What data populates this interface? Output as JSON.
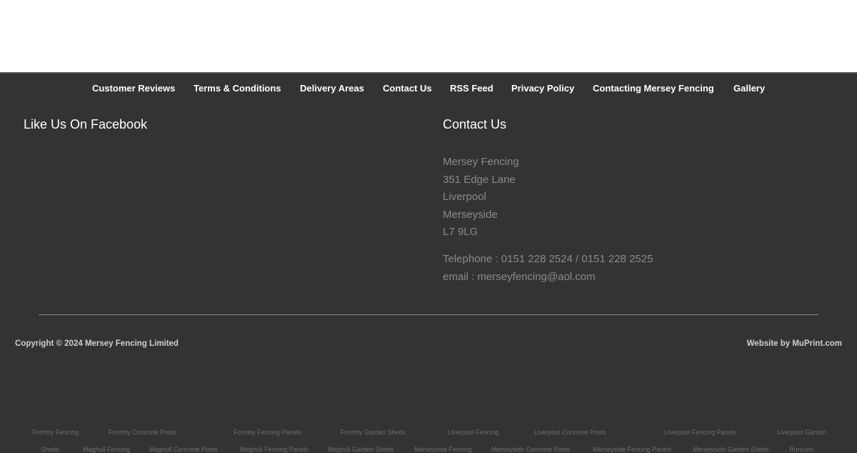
{
  "nav": {
    "items": [
      {
        "label": "Customer Reviews"
      },
      {
        "label": "Terms & Conditions"
      },
      {
        "label": "Delivery Areas"
      },
      {
        "label": "Contact Us"
      },
      {
        "label": "RSS Feed"
      },
      {
        "label": "Privacy Policy"
      },
      {
        "label": "Contacting Mersey Fencing"
      },
      {
        "label": "Gallery"
      }
    ]
  },
  "facebook": {
    "heading": "Like Us On Facebook"
  },
  "contact": {
    "heading": "Contact Us",
    "address": [
      "Mersey Fencing",
      "351 Edge Lane",
      "Liverpool",
      "Merseyside",
      "L7 9LG"
    ],
    "telephone": "Telephone : 0151 228 2524 / 0151 228 2525",
    "email": "email : merseyfencing@aol.com"
  },
  "copyright": "Copyright ©  2024 Mersey Fencing Limited",
  "website_by": "Website by MuPrint.com",
  "seo_links": [
    "Formby Fencing",
    "Formby Concrete Posts",
    "Formby Fencing Panels",
    "Formby Garden Sheds",
    "Liverpool Fencing",
    "Liverpool Concrete Posts",
    "Liverpool Fencing Panels",
    "Liverpool Garden",
    "Sheds",
    "Maghull Fencing",
    "Maghull Concrete Posts",
    "Maghull Fencing Panels",
    "Maghull Garden Sheds",
    "Merseyside Fencing",
    "Merseyside Concrete Posts",
    "Merseyside Fencing Panels",
    "Merseyside Garden Sheds",
    "Runcorn"
  ]
}
